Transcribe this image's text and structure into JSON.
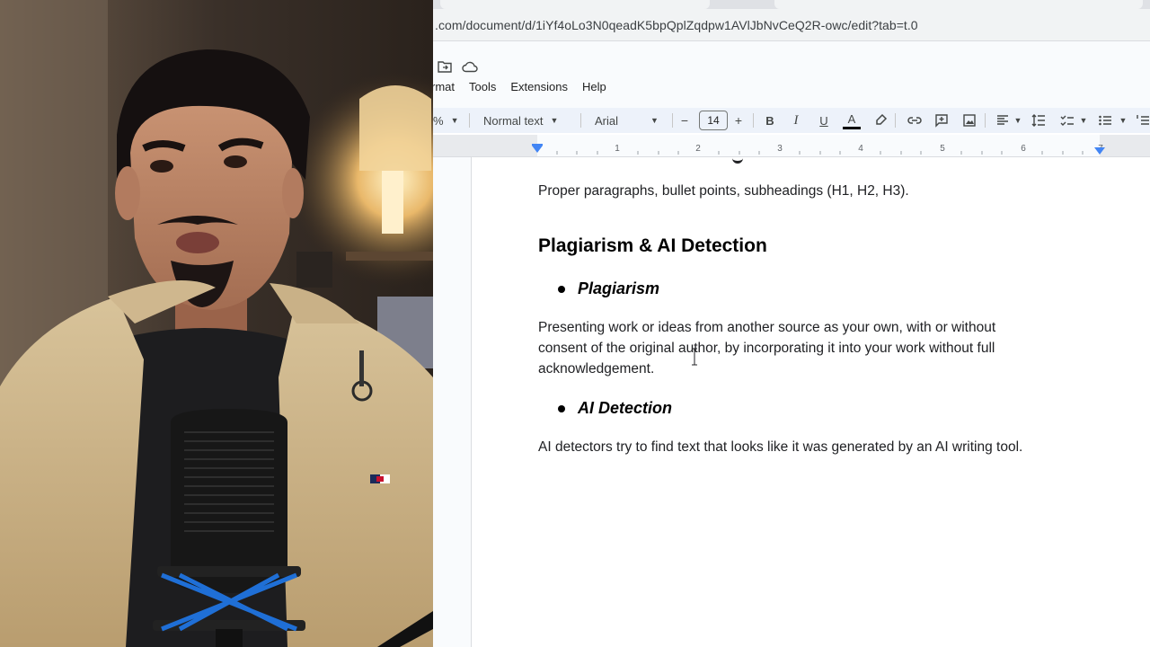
{
  "browser": {
    "url": ".com/document/d/1iYf4oLo3N0qeadK5bpQplZqdpw1AVlJbNvCeQ2R-owc/edit?tab=t.0"
  },
  "docs": {
    "header_icons": [
      "folder-move-icon",
      "cloud-saved-icon"
    ],
    "menu": [
      "rmat",
      "Tools",
      "Extensions",
      "Help"
    ],
    "toolbar": {
      "zoom_suffix": "%",
      "paragraph_style": "Normal text",
      "font": "Arial",
      "font_size": "14",
      "decrease": "−",
      "increase": "+",
      "bold": "B",
      "italic": "I",
      "underline": "U",
      "text_color": "A"
    },
    "ruler_numbers": [
      "1",
      "2",
      "3",
      "4",
      "5",
      "6",
      "7"
    ]
  },
  "document": {
    "line1": "Proper paragraphs, bullet points, subheadings (H1, H2, H3).",
    "heading": "Plagiarism & AI Detection",
    "bullet1": "Plagiarism",
    "para1_line1": "Presenting work or ideas from another source as your own, with or without",
    "para1_line2": "consent of the original author, by incorporating it into your work without full",
    "para1_line3": "acknowledgement.",
    "bullet2": "AI Detection",
    "para2": "AI detectors try to find text that looks like it was generated by an AI writing tool."
  },
  "colors": {
    "toolbar_bg": "#edf2fa",
    "text_color_underline": "#000000",
    "ruler_marker": "#4285f4"
  }
}
